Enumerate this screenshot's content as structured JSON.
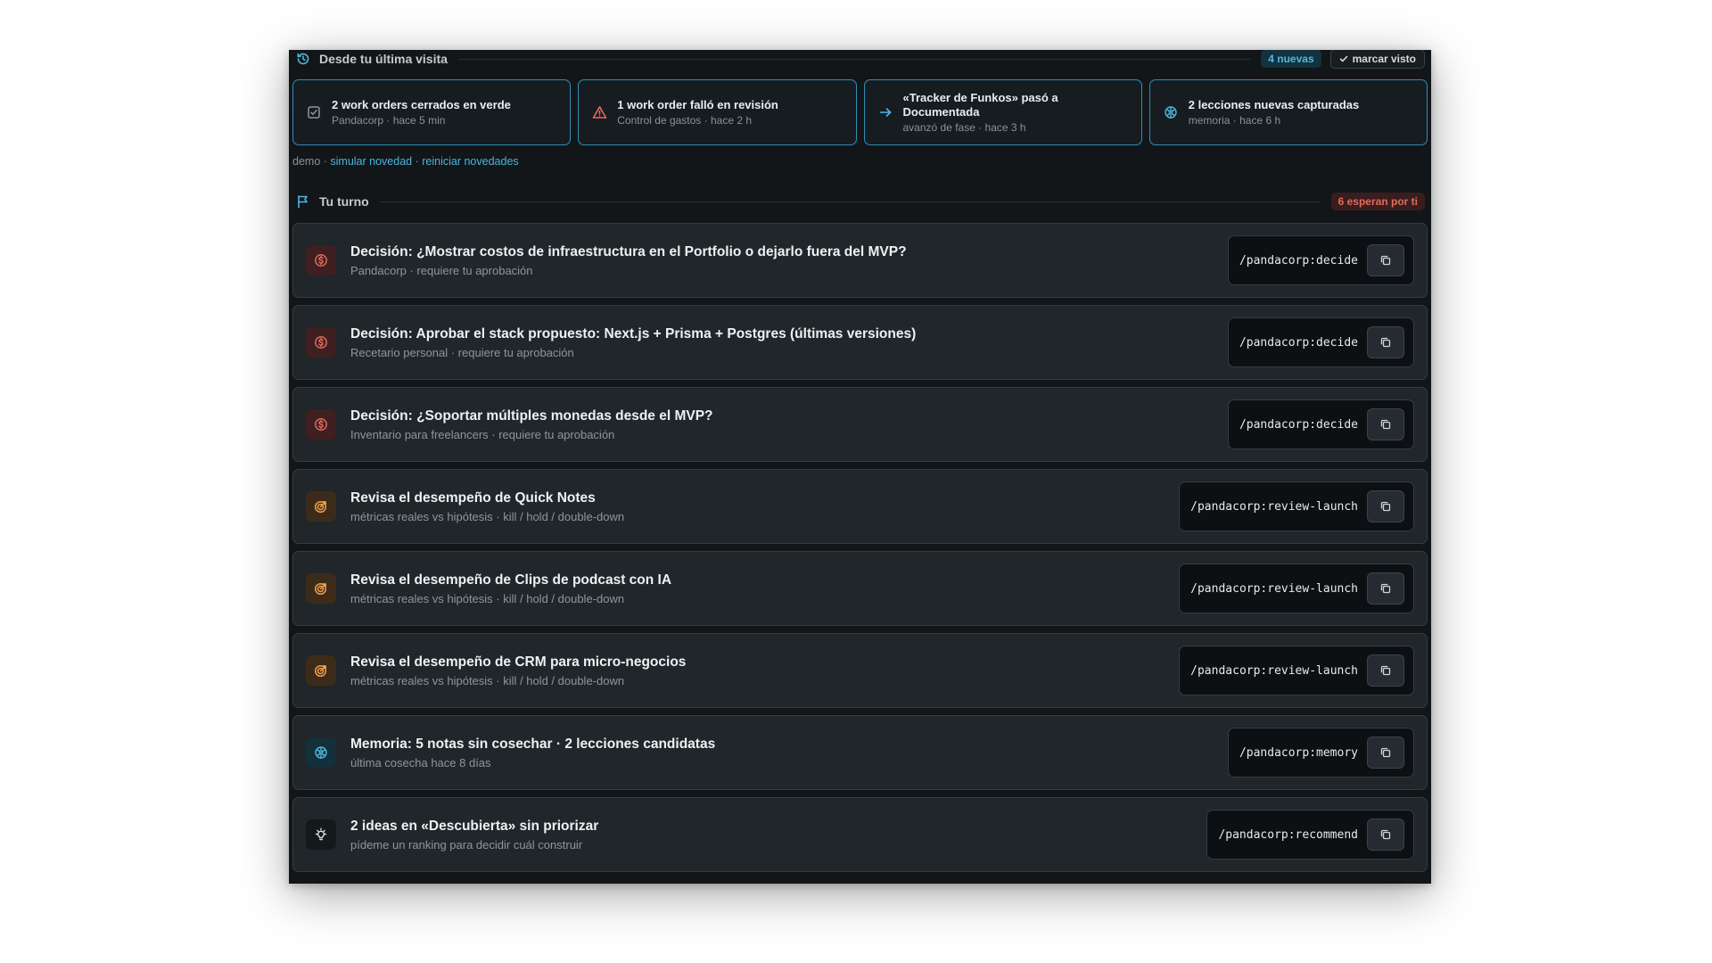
{
  "since": {
    "title": "Desde tu última visita",
    "icon": "history-icon",
    "new_badge": "4 nuevas",
    "mark_seen_label": "marcar visto",
    "accent_color": "#2e8fb8",
    "items": [
      {
        "icon": "check-square-icon",
        "title": "2 work orders cerrados en verde",
        "subtitle": "Pandacorp · hace 5 min"
      },
      {
        "icon": "warning-triangle-icon",
        "title": "1 work order falló en revisión",
        "subtitle": "Control de gastos · hace 2 h"
      },
      {
        "icon": "arrow-right-icon",
        "title": "«Tracker de Funkos» pasó a Documentada",
        "subtitle": "avanzó de fase · hace 3 h"
      },
      {
        "icon": "brain-icon",
        "title": "2 lecciones nuevas capturadas",
        "subtitle": "memoria · hace 6 h"
      }
    ]
  },
  "demo": {
    "prefix": "demo ·",
    "simulate": "simular novedad",
    "sep": "·",
    "reset": "reiniciar novedades"
  },
  "turn": {
    "title": "Tu turno",
    "icon": "flag-icon",
    "waiting_badge": "6 esperan por ti",
    "tasks": [
      {
        "kind": "decision",
        "icon": "dollar-icon",
        "title": "Decisión: ¿Mostrar costos de infraestructura en el Portfolio o dejarlo fuera del MVP?",
        "subtitle": "Pandacorp · requiere tu aprobación",
        "command": "/pandacorp:decide"
      },
      {
        "kind": "decision",
        "icon": "dollar-icon",
        "title": "Decisión: Aprobar el stack propuesto: Next.js + Prisma + Postgres (últimas versiones)",
        "subtitle": "Recetario personal · requiere tu aprobación",
        "command": "/pandacorp:decide"
      },
      {
        "kind": "decision",
        "icon": "dollar-icon",
        "title": "Decisión: ¿Soportar múltiples monedas desde el MVP?",
        "subtitle": "Inventario para freelancers · requiere tu aprobación",
        "command": "/pandacorp:decide"
      },
      {
        "kind": "review",
        "icon": "target-icon",
        "title": "Revisa el desempeño de Quick Notes",
        "subtitle": "métricas reales vs hipótesis · kill / hold / double-down",
        "command": "/pandacorp:review-launch"
      },
      {
        "kind": "review",
        "icon": "target-icon",
        "title": "Revisa el desempeño de Clips de podcast con IA",
        "subtitle": "métricas reales vs hipótesis · kill / hold / double-down",
        "command": "/pandacorp:review-launch"
      },
      {
        "kind": "review",
        "icon": "target-icon",
        "title": "Revisa el desempeño de CRM para micro-negocios",
        "subtitle": "métricas reales vs hipótesis · kill / hold / double-down",
        "command": "/pandacorp:review-launch"
      },
      {
        "kind": "memory",
        "icon": "brain-icon",
        "title": "Memoria: 5 notas sin cosechar · 2 lecciones candidatas",
        "subtitle": "última cosecha hace 8 días",
        "command": "/pandacorp:memory"
      },
      {
        "kind": "idea",
        "icon": "lightbulb-icon",
        "title": "2 ideas en «Descubierta» sin priorizar",
        "subtitle": "pídeme un ranking para decidir cuál construir",
        "command": "/pandacorp:recommend"
      }
    ]
  }
}
